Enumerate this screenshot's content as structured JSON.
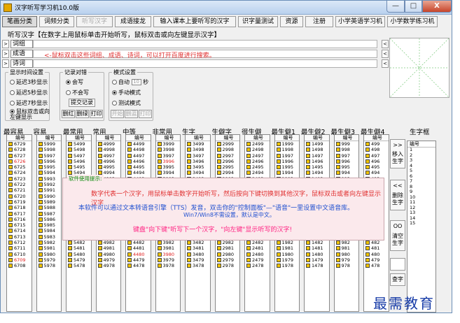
{
  "window": {
    "title": "汉字听写学习机10.0版",
    "min": "—",
    "max": "□",
    "close": "X"
  },
  "menu": [
    {
      "label": "笔画分类",
      "state": "active"
    },
    {
      "label": "词频分类",
      "state": "normal"
    },
    {
      "label": "听写汉字",
      "state": "disabled"
    },
    {
      "label": "成语接龙",
      "state": "normal"
    },
    {
      "label": "输入课本上要听写的汉字",
      "state": "normal"
    },
    {
      "label": "识字量测试",
      "state": "normal"
    },
    {
      "label": "资源",
      "state": "normal"
    },
    {
      "label": "注册",
      "state": "normal"
    },
    {
      "label": "小学英语学习机",
      "state": "normal"
    },
    {
      "label": "小学数学练习机",
      "state": "normal"
    }
  ],
  "dictation_title": "听写汉字【在数字上用鼠标单击开始听写，鼠标双击或向左键显示汉字】",
  "rows": [
    {
      "label": "词组",
      "arrow": ">",
      "rarrow": "<"
    },
    {
      "label": "成语",
      "arrow": ">",
      "rarrow": "<"
    },
    {
      "label": "诗词",
      "arrow": ">",
      "rarrow": "<"
    }
  ],
  "hint": "<-鼠标双击这些词组、成语、诗词，可以打开百度进行搜索。",
  "display_group": {
    "title": "显示时间设置",
    "options": [
      "延迟3秒显示",
      "延迟5秒显示",
      "延迟7秒显示",
      "鼠标双击或向左键显示"
    ]
  },
  "record_group": {
    "title": "记录对错",
    "options": [
      "会写",
      "不会写"
    ],
    "submit": "提交记录",
    "buttons": [
      "删红",
      "删绿",
      "打印"
    ]
  },
  "mode_group": {
    "title": "模式设置",
    "auto": "自动",
    "auto_value": "10",
    "auto_unit": "秒",
    "manual": "手动模式",
    "test": "测试模式",
    "buttons": [
      "开始",
      "删蓝",
      "打印"
    ]
  },
  "columns": [
    {
      "title": "最容易",
      "values": [
        "6729",
        "6728",
        "6727",
        "6726",
        "6725",
        "6724",
        "6723",
        "6722",
        "6721",
        "6720",
        "6719",
        "6718",
        "6717",
        "6716",
        "6715",
        "6714",
        "6713",
        "6712",
        "6711",
        "6710",
        "6709",
        "6708"
      ],
      "red": [
        3,
        20
      ]
    },
    {
      "title": "容易",
      "values": [
        "5999",
        "5998",
        "5997",
        "5996",
        "5995",
        "5994",
        "5993",
        "5992",
        "5991",
        "5990",
        "5989",
        "5988",
        "5987",
        "5986",
        "5985",
        "5984",
        "5983",
        "5982",
        "5981",
        "5980",
        "5979",
        "5978"
      ],
      "red": []
    },
    {
      "title": "最常用",
      "values": [
        "5499",
        "5498",
        "5497",
        "5496",
        "5495",
        "5494",
        "5493",
        "5492",
        "5491",
        "5490",
        "5489",
        "5488",
        "5487",
        "5486",
        "5485",
        "5484",
        "5483",
        "5482",
        "5481",
        "5480",
        "5479",
        "5478"
      ],
      "red": []
    },
    {
      "title": "常用",
      "values": [
        "4999",
        "4998",
        "4997",
        "4996",
        "4995",
        "4994",
        "4993",
        "4992",
        "4991",
        "4990",
        "4989",
        "4988",
        "4987",
        "4986",
        "4985",
        "4984",
        "4983",
        "4982",
        "4981",
        "4980",
        "4979",
        "4978"
      ],
      "red": []
    },
    {
      "title": "中等",
      "values": [
        "4499",
        "4498",
        "4497",
        "4496",
        "4495",
        "4494",
        "4493",
        "4492",
        "4491",
        "4490",
        "4489",
        "4488",
        "4487",
        "4486",
        "4485",
        "4484",
        "4483",
        "4482",
        "4481",
        "4480",
        "4479",
        "4478"
      ],
      "red": [
        19
      ]
    },
    {
      "title": "非常用",
      "values": [
        "3999",
        "3998",
        "3997",
        "3996",
        "3995",
        "3994",
        "3993",
        "3992",
        "3991",
        "3990",
        "3989",
        "3988",
        "3987",
        "3986",
        "3985",
        "3984",
        "3983",
        "3982",
        "3981",
        "3980",
        "3979",
        "3978"
      ],
      "red": [
        3,
        19
      ]
    },
    {
      "title": "生字",
      "values": [
        "3499",
        "3498",
        "3497",
        "3496",
        "3495",
        "3494",
        "3493",
        "3492",
        "3491",
        "3490",
        "3489",
        "3488",
        "3487",
        "3486",
        "3485",
        "3484",
        "3483",
        "3482",
        "3481",
        "3480",
        "3479",
        "3478"
      ],
      "red": []
    },
    {
      "title": "生僻字",
      "values": [
        "2999",
        "2998",
        "2997",
        "2996",
        "2995",
        "2994",
        "2993",
        "2992",
        "2991",
        "2990",
        "2989",
        "2988",
        "2987",
        "2986",
        "2985",
        "2984",
        "2983",
        "2982",
        "2981",
        "2980",
        "2979",
        "2978"
      ],
      "red": []
    },
    {
      "title": "很生僻",
      "values": [
        "2499",
        "2498",
        "2497",
        "2496",
        "2495",
        "2494",
        "2493",
        "2492",
        "2491",
        "2490",
        "2489",
        "2488",
        "2487",
        "2486",
        "2485",
        "2484",
        "2483",
        "2482",
        "2481",
        "2480",
        "2479",
        "2478"
      ],
      "red": []
    },
    {
      "title": "最生僻1",
      "values": [
        "1999",
        "1998",
        "1997",
        "1996",
        "1995",
        "1994",
        "1993",
        "1992",
        "1991",
        "1990",
        "1989",
        "1988",
        "1987",
        "1986",
        "1985",
        "1984",
        "1983",
        "1982",
        "1981",
        "1980",
        "1979",
        "1978"
      ],
      "red": []
    },
    {
      "title": "最生僻2",
      "values": [
        "1499",
        "1498",
        "1497",
        "1496",
        "1495",
        "1494",
        "1493",
        "1492",
        "1491",
        "1490",
        "1489",
        "1488",
        "1487",
        "1486",
        "1485",
        "1484",
        "1483",
        "1482",
        "1481",
        "1480",
        "1479",
        "1478"
      ],
      "red": []
    },
    {
      "title": "最生僻3",
      "values": [
        "999",
        "998",
        "997",
        "996",
        "995",
        "994",
        "993",
        "992",
        "991",
        "990",
        "989",
        "988",
        "987",
        "986",
        "985",
        "984",
        "983",
        "982",
        "981",
        "980",
        "979",
        "978"
      ],
      "red": []
    },
    {
      "title": "最生僻4",
      "values": [
        "499",
        "498",
        "497",
        "496",
        "495",
        "494",
        "493",
        "492",
        "491",
        "490",
        "489",
        "488",
        "487",
        "486",
        "485",
        "484",
        "483",
        "482",
        "481",
        "480",
        "479",
        "478"
      ],
      "red": []
    }
  ],
  "col_header": "编号",
  "shengzi": {
    "title": "生字框",
    "header": "编号",
    "values": [
      "1",
      "2",
      "3",
      "4",
      "5",
      "6",
      "7",
      "8",
      "9",
      "10",
      "11",
      "12",
      "13",
      "14",
      "15"
    ]
  },
  "side_buttons": [
    {
      "arrow": ">>",
      "label": "移入生字"
    },
    {
      "arrow": "<<",
      "label": "删除生字"
    },
    {
      "arrow": "OO",
      "label": "清空生字"
    },
    {
      "arrow": "",
      "label": "查字"
    }
  ],
  "popup": {
    "title": "软件使用提示:",
    "line1": "数字代表一个汉字，用鼠标单击数字开始听写，然后按向下键切换到其他汉字，鼠标双击或者向左键显示汉字",
    "line2": "本软件可以通过文本转语音引擎（TTS）发音，双击你的\"控制面板\"—\"语音\"一里设置中文语音库。",
    "line3": "Win7/Win8不需设置，默认是中文。",
    "line4": "键盘\"向下键\"听写下一个汉字，\"向左键\"显示听写的汉字!"
  },
  "watermark": "最需教育"
}
